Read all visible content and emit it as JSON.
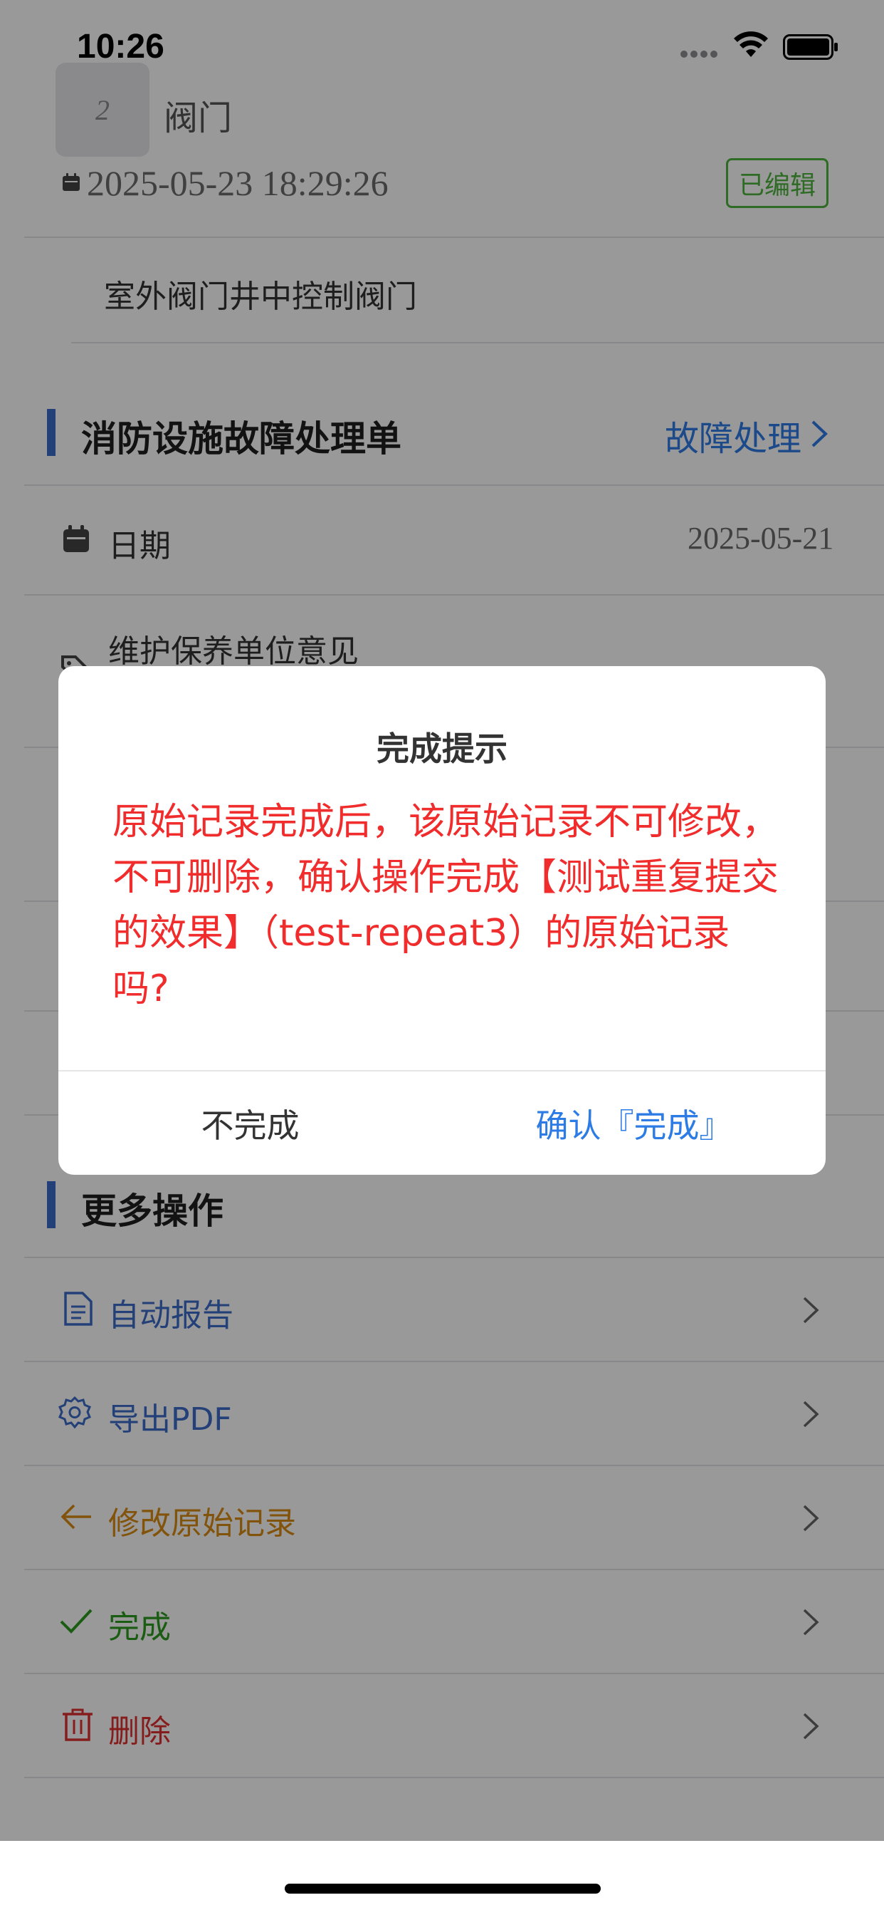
{
  "status_bar": {
    "time": "10:26"
  },
  "record": {
    "number": "2",
    "title": "阀门",
    "datetime": "2025-05-23 18:29:26",
    "tag": "已编辑",
    "description": "室外阀门井中控制阀门"
  },
  "fault_section": {
    "title": "消防设施故障处理单",
    "link_label": "故障处理",
    "date_label": "日期",
    "date_value": "2025-05-21",
    "opinion_label": "维护保养单位意见"
  },
  "more_section": {
    "title": "更多操作",
    "actions": [
      {
        "label": "自动报告",
        "icon": "document-icon",
        "color": "#3d6bc9"
      },
      {
        "label": "导出PDF",
        "icon": "gear-icon",
        "color": "#3d6bc9"
      },
      {
        "label": "修改原始记录",
        "icon": "arrow-left-icon",
        "color": "#d98a12"
      },
      {
        "label": "完成",
        "icon": "checkmark-icon",
        "color": "#2c9c1e"
      },
      {
        "label": "删除",
        "icon": "trash-icon",
        "color": "#e03131"
      }
    ]
  },
  "dialog": {
    "title": "完成提示",
    "message": "原始记录完成后，该原始记录不可修改，不可删除，确认操作完成【测试重复提交的效果】（test-repeat3）的原始记录吗?",
    "cancel_label": "不完成",
    "confirm_label": "确认『完成』"
  },
  "colors": {
    "accent": "#3d6bc9",
    "link": "#2d7be5",
    "warning_text": "#f02c2c",
    "edited_tag": "#4db33d"
  }
}
